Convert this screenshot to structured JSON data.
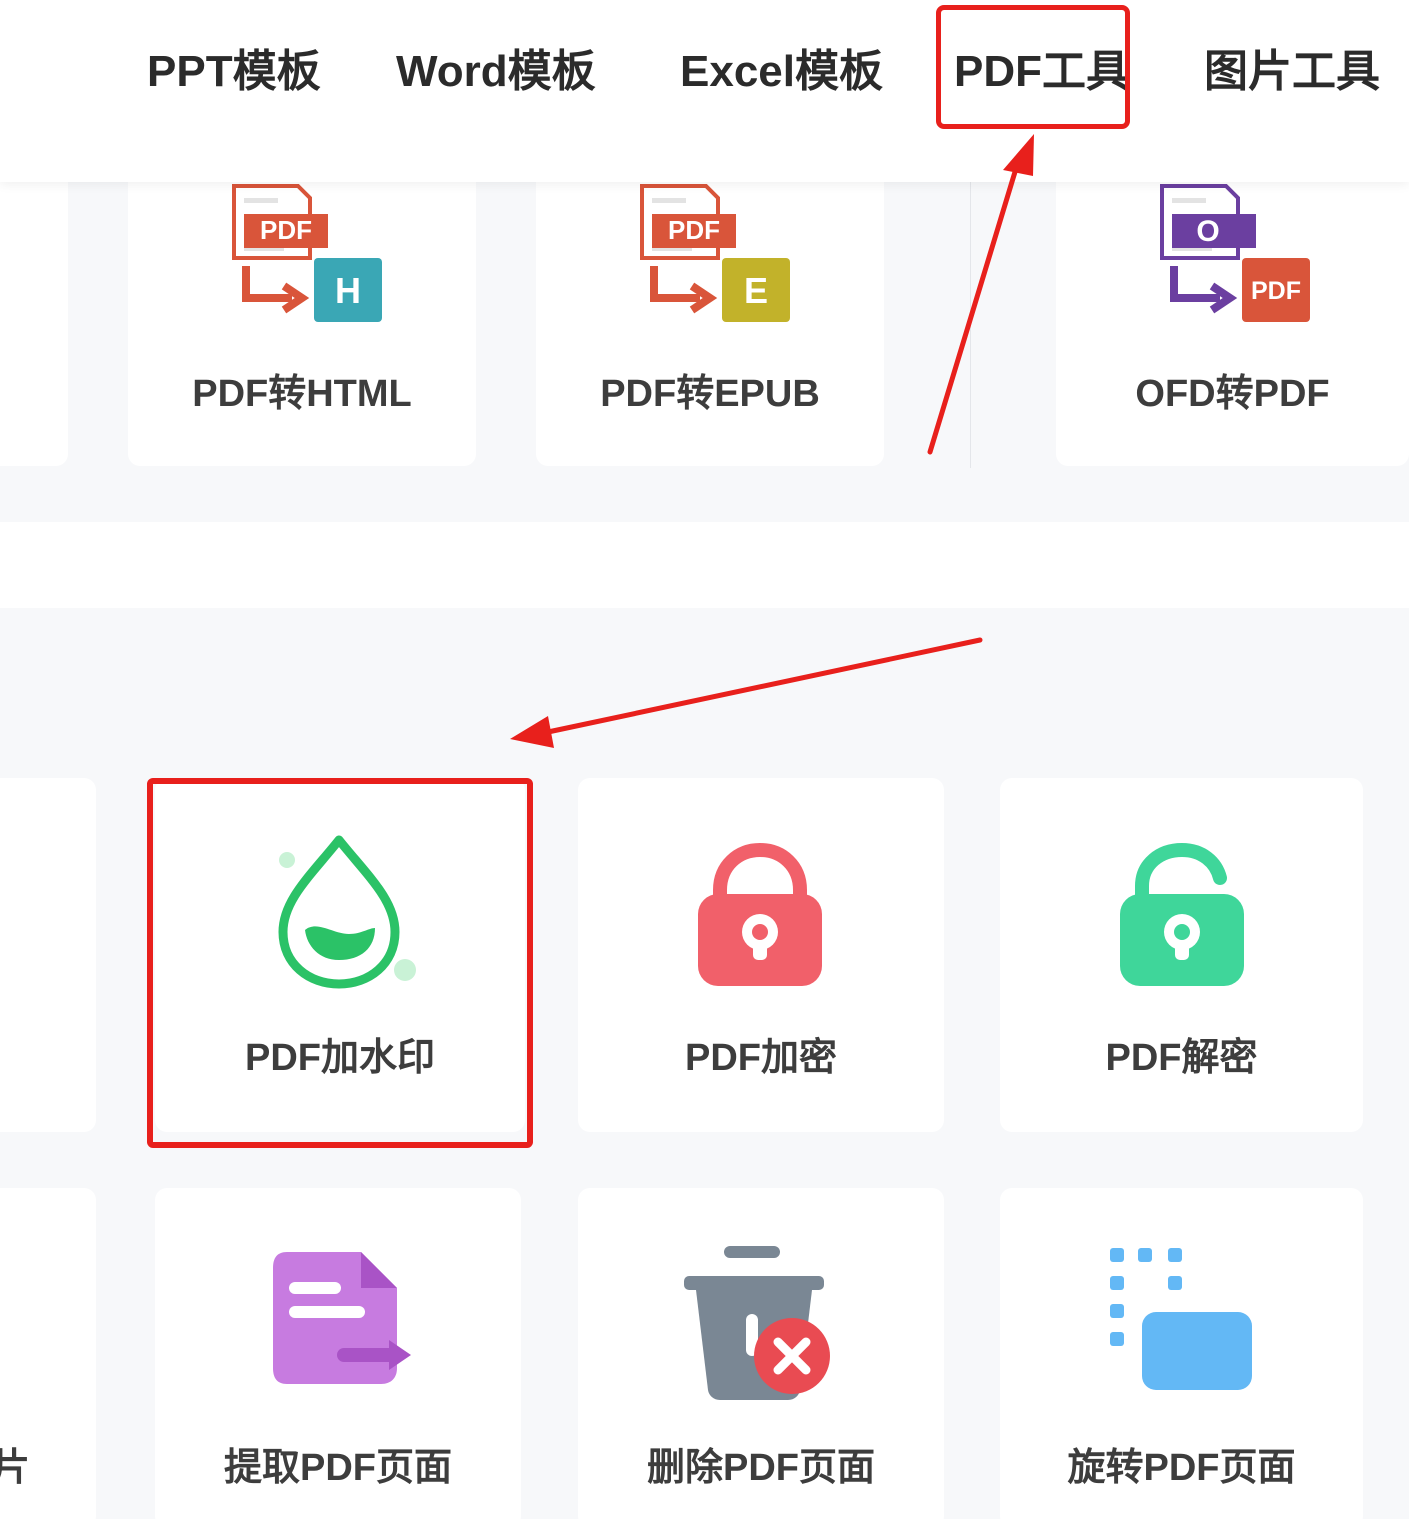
{
  "nav": {
    "items": [
      {
        "label": "PPT模板"
      },
      {
        "label": "Word模板"
      },
      {
        "label": "Excel模板"
      },
      {
        "label": "PDF工具"
      },
      {
        "label": "图片工具"
      }
    ],
    "highlighted": "PDF工具"
  },
  "convert_tools": [
    {
      "label": "PDF转HTML",
      "icon": "pdf-to-html-icon",
      "badge_from": "PDF",
      "badge_to": "H",
      "color": "#3aa7b5"
    },
    {
      "label": "PDF转EPUB",
      "icon": "pdf-to-epub-icon",
      "badge_from": "PDF",
      "badge_to": "E",
      "color": "#c2b22a"
    },
    {
      "label": "OFD转PDF",
      "icon": "ofd-to-pdf-icon",
      "badge_from": "O",
      "badge_to": "PDF",
      "color": "#6b3fa0"
    }
  ],
  "security_tools": [
    {
      "label": "PDF加水印",
      "icon": "watermark-drop-icon",
      "color": "#2bc267",
      "highlighted": true
    },
    {
      "label": "PDF加密",
      "icon": "lock-closed-icon",
      "color": "#f1606a"
    },
    {
      "label": "PDF解密",
      "icon": "lock-open-icon",
      "color": "#3fd69a"
    }
  ],
  "page_tools": {
    "partial_label": "片",
    "items": [
      {
        "label": "提取PDF页面",
        "icon": "extract-page-icon",
        "color": "#c77be0"
      },
      {
        "label": "删除PDF页面",
        "icon": "delete-page-icon",
        "color": "#e94b52"
      },
      {
        "label": "旋转PDF页面",
        "icon": "rotate-page-icon",
        "color": "#63b8f5"
      }
    ]
  },
  "colors": {
    "highlight": "#e8201c",
    "pdf_badge": "#d9553a"
  }
}
